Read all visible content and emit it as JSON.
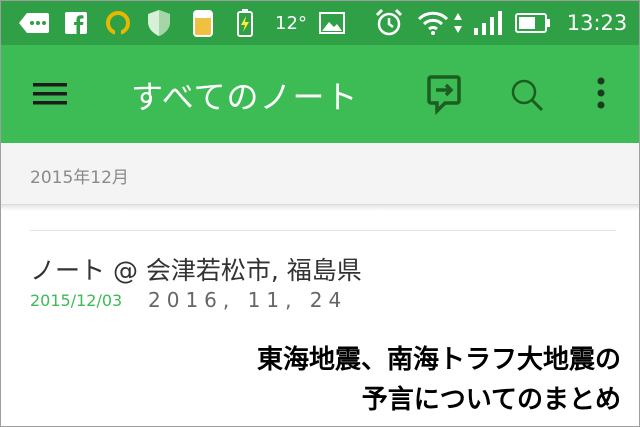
{
  "status_bar": {
    "temperature": "12°",
    "time": "13:23",
    "icons": [
      "back-arrow-icon",
      "facebook-icon",
      "sync-ring-icon",
      "shield-icon",
      "beer-icon",
      "battery-charging-icon",
      "image-icon",
      "alarm-icon",
      "wifi-icon",
      "signal-icon",
      "battery-icon"
    ]
  },
  "app_bar": {
    "title": "すべてのノート",
    "icons": [
      "menu-icon",
      "sync-icon",
      "search-icon",
      "more-vertical-icon"
    ]
  },
  "section": {
    "label": "2015年12月"
  },
  "note": {
    "title": "ノート @ 会津若松市, 福島県",
    "date": "2015/12/03",
    "snippet": "2016, 11, 24"
  },
  "caption": {
    "line1": "東海地震、南海トラフ大地震の",
    "line2": "予言についてのまとめ"
  },
  "colors": {
    "status_bar": "#2fa046",
    "app_bar": "#3dbb55",
    "accent_green": "#3dbb55",
    "section_bg": "#f4f4f4"
  }
}
